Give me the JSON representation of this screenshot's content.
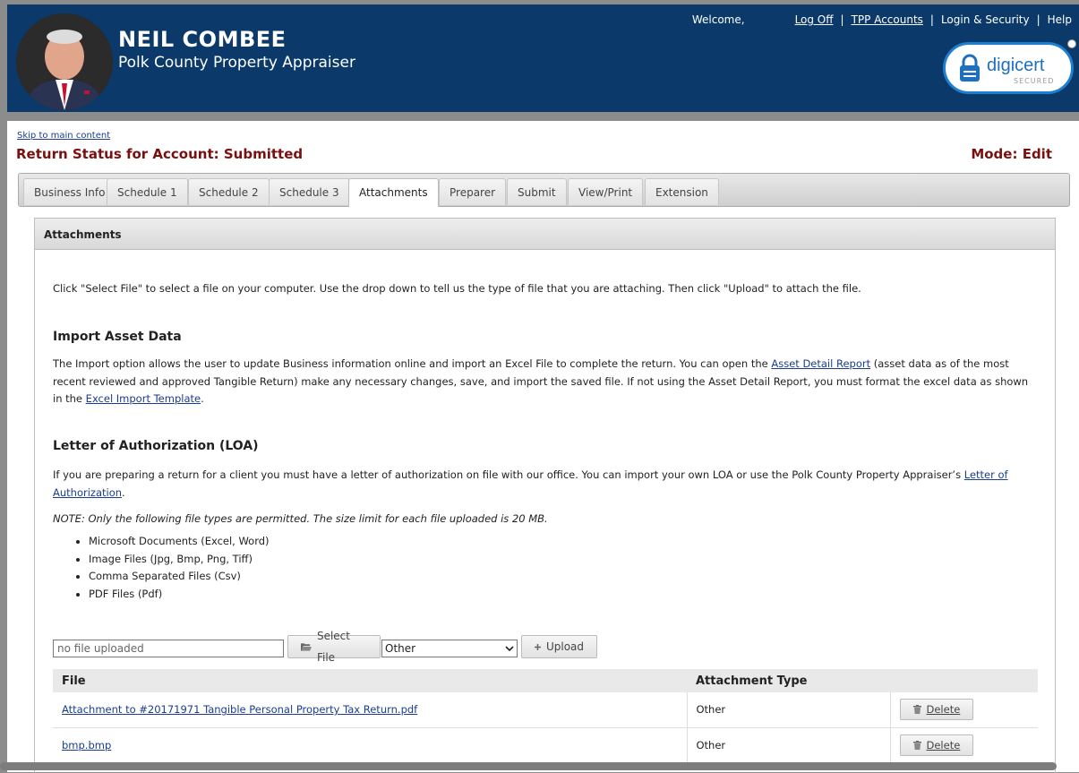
{
  "header": {
    "name": "NEIL COMBEE",
    "subtitle": "Polk County Property Appraiser",
    "welcome": "Welcome,",
    "nav": {
      "logoff": "Log Off",
      "tpp": "TPP Accounts",
      "login_security": "Login & Security",
      "help": "Help",
      "sep": "|"
    },
    "seal": {
      "brand": "digicert",
      "secured": "SECURED"
    }
  },
  "skip_link": "Skip to main content",
  "status_title": "Return Status for Account: Submitted",
  "mode_title": "Mode: Edit",
  "tabs": [
    {
      "label": "Business Info"
    },
    {
      "label": "Schedule 1"
    },
    {
      "label": "Schedule 2"
    },
    {
      "label": "Schedule 3"
    },
    {
      "label": "Attachments",
      "active": true
    },
    {
      "label": "Preparer"
    },
    {
      "label": "Submit"
    },
    {
      "label": "View/Print"
    },
    {
      "label": "Extension"
    }
  ],
  "panel": {
    "title": "Attachments",
    "intro": "Click \"Select File\" to select a file on your computer. Use the drop down to tell us the type of file that you are attaching. Then click \"Upload\" to attach the file.",
    "import": {
      "heading": "Import Asset Data",
      "text1": "The Import option allows the user to update Business information online and import an Excel File to complete the return. You can open the ",
      "link1": "Asset Detail Report",
      "text2": " (asset data as of the most recent reviewed and approved Tangible Return) make any necessary changes, save, and import the saved file. If not using the Asset Detail Report, you must format the excel data as shown in the ",
      "link2": "Excel Import Template",
      "text3": "."
    },
    "loa": {
      "heading": "Letter of Authorization (LOA)",
      "text1": "If you are preparing a return for a client you must have a letter of authorization on file with our office. You can import your own LOA or use the Polk County Property Appraiser’s ",
      "link": "Letter of Authorization",
      "text2": "."
    },
    "note": "NOTE: Only the following file types are permitted. The size limit for each file uploaded is 20 MB.",
    "file_types": [
      "Microsoft Documents (Excel, Word)",
      "Image Files (Jpg, Bmp, Png, Tiff)",
      "Comma Separated Files (Csv)",
      "PDF Files (Pdf)"
    ],
    "upload": {
      "file_value": "no file uploaded",
      "select_file_label": "Select File",
      "type_selected": "Other",
      "upload_label": "Upload"
    },
    "table": {
      "headers": [
        "File",
        "Attachment Type",
        ""
      ],
      "rows": [
        {
          "file": "Attachment to #20171971 Tangible Personal Property Tax Return.pdf",
          "type": "Other",
          "action": "Delete"
        },
        {
          "file": "bmp.bmp",
          "type": "Other",
          "action": "Delete"
        }
      ]
    }
  },
  "colors": {
    "header_bg": "#0b3a6a",
    "title_red": "#7a0f0f",
    "link_blue": "#1a3d8f"
  }
}
